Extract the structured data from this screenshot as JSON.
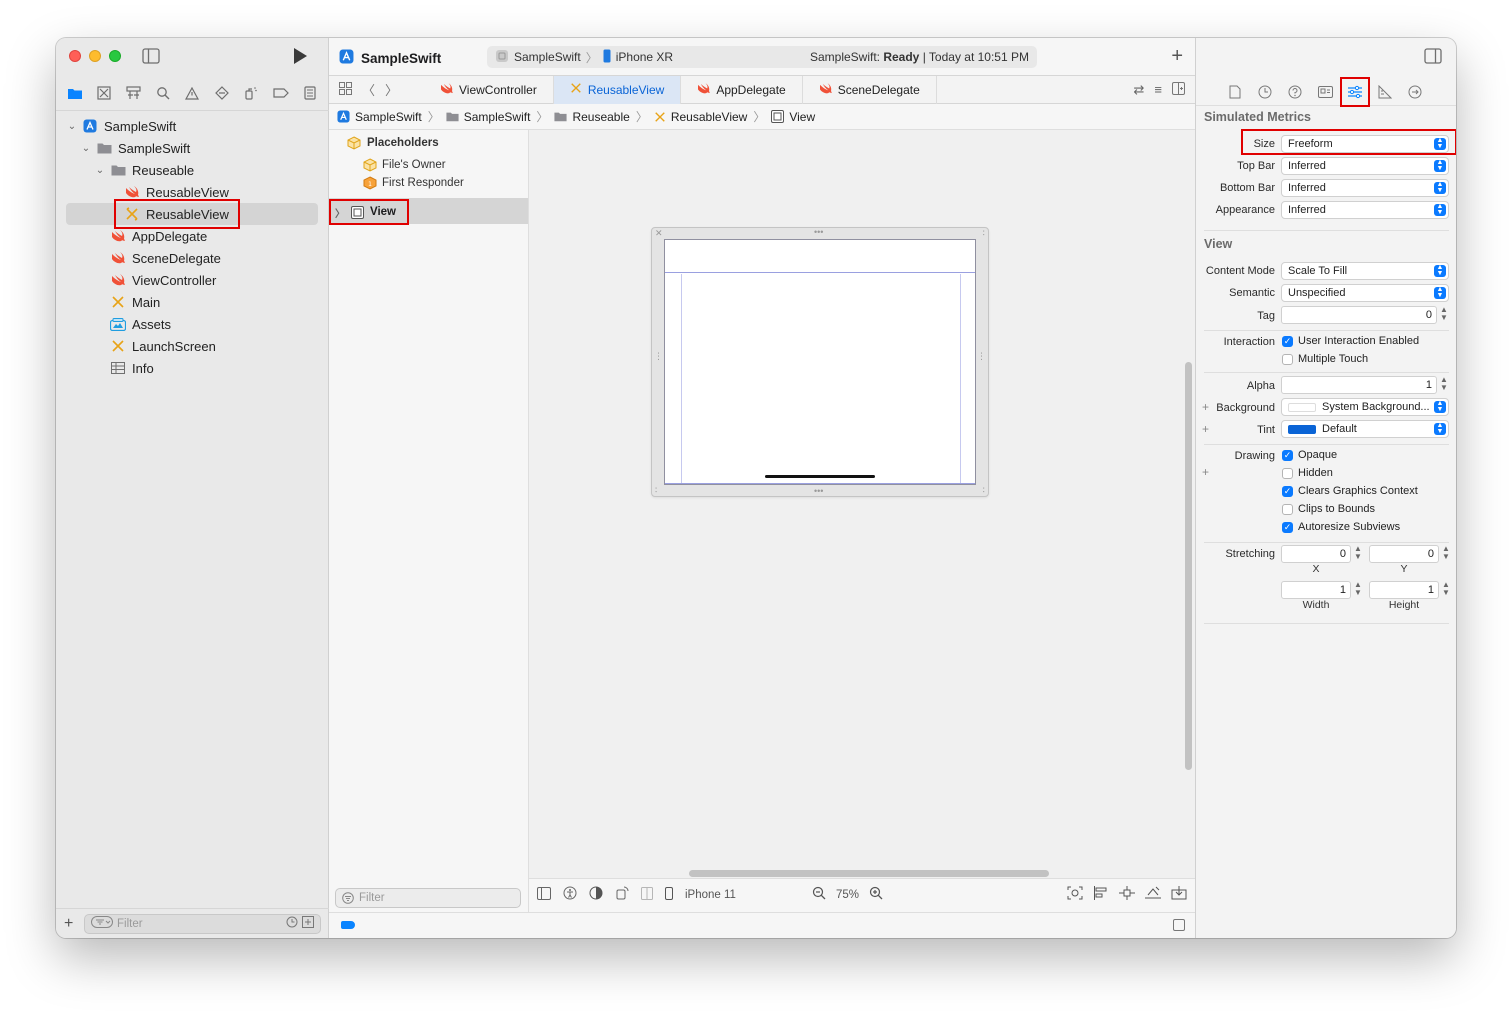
{
  "app": {
    "title": "SampleSwift"
  },
  "scheme": {
    "project": "SampleSwift",
    "device": "iPhone XR",
    "status_prefix": "SampleSwift: ",
    "status_state": "Ready",
    "status_time": " | Today at 10:51 PM"
  },
  "navigator": {
    "tree": [
      {
        "label": "SampleSwift",
        "icon": "app-project-icon",
        "depth": 0,
        "chevron": "open"
      },
      {
        "label": "SampleSwift",
        "icon": "folder-icon",
        "depth": 1,
        "chevron": "open"
      },
      {
        "label": "Reuseable",
        "icon": "folder-icon",
        "depth": 2,
        "chevron": "open"
      },
      {
        "label": "ReusableView",
        "icon": "swift-file-icon",
        "depth": 3
      },
      {
        "label": "ReusableView",
        "icon": "xib-file-icon",
        "depth": 3,
        "selected": true
      },
      {
        "label": "AppDelegate",
        "icon": "swift-file-icon",
        "depth": 2
      },
      {
        "label": "SceneDelegate",
        "icon": "swift-file-icon",
        "depth": 2
      },
      {
        "label": "ViewController",
        "icon": "swift-file-icon",
        "depth": 2
      },
      {
        "label": "Main",
        "icon": "storyboard-file-icon",
        "depth": 2
      },
      {
        "label": "Assets",
        "icon": "asset-catalog-icon",
        "depth": 2
      },
      {
        "label": "LaunchScreen",
        "icon": "storyboard-file-icon",
        "depth": 2
      },
      {
        "label": "Info",
        "icon": "plist-table-icon",
        "depth": 2
      }
    ],
    "filter_placeholder": "Filter"
  },
  "tabs": [
    {
      "label": "ViewController",
      "icon": "swift-file-icon"
    },
    {
      "label": "ReusableView",
      "icon": "xib-file-icon",
      "active": true
    },
    {
      "label": "AppDelegate",
      "icon": "swift-file-icon"
    },
    {
      "label": "SceneDelegate",
      "icon": "swift-file-icon"
    }
  ],
  "jumpbar": [
    {
      "label": "SampleSwift",
      "icon": "app-project-icon"
    },
    {
      "label": "SampleSwift",
      "icon": "folder-icon"
    },
    {
      "label": "Reuseable",
      "icon": "folder-icon"
    },
    {
      "label": "ReusableView",
      "icon": "xib-file-icon"
    },
    {
      "label": "View",
      "icon": "view-icon"
    }
  ],
  "outline": {
    "placeholders": "Placeholders",
    "files_owner": "File's Owner",
    "first_responder": "First Responder",
    "view": "View",
    "filter_placeholder": "Filter"
  },
  "canvas_bar": {
    "device": "iPhone 11",
    "zoom": "75%"
  },
  "inspector": {
    "simulated_metrics": {
      "title": "Simulated Metrics",
      "size_label": "Size",
      "size_value": "Freeform",
      "top_bar_label": "Top Bar",
      "top_bar_value": "Inferred",
      "bottom_bar_label": "Bottom Bar",
      "bottom_bar_value": "Inferred",
      "appearance_label": "Appearance",
      "appearance_value": "Inferred"
    },
    "view": {
      "title": "View",
      "content_mode_label": "Content Mode",
      "content_mode_value": "Scale To Fill",
      "semantic_label": "Semantic",
      "semantic_value": "Unspecified",
      "tag_label": "Tag",
      "tag_value": "0",
      "interaction_label": "Interaction",
      "user_interaction": "User Interaction Enabled",
      "user_interaction_checked": true,
      "multiple_touch": "Multiple Touch",
      "multiple_touch_checked": false,
      "alpha_label": "Alpha",
      "alpha_value": "1",
      "background_label": "Background",
      "background_value": "System Background...",
      "tint_label": "Tint",
      "tint_value": "Default",
      "tint_color": "#0a64d6",
      "drawing_label": "Drawing",
      "opaque": "Opaque",
      "opaque_checked": true,
      "hidden": "Hidden",
      "hidden_checked": false,
      "clears_graphics": "Clears Graphics Context",
      "clears_graphics_checked": true,
      "clips_bounds": "Clips to Bounds",
      "clips_bounds_checked": false,
      "autoresize": "Autoresize Subviews",
      "autoresize_checked": true,
      "stretching_label": "Stretching",
      "stretch_x": "0",
      "stretch_y": "0",
      "stretch_w": "1",
      "stretch_h": "1",
      "x_label": "X",
      "y_label": "Y",
      "width_label": "Width",
      "height_label": "Height"
    }
  },
  "colors": {
    "accent": "#0a84ff",
    "highlight": "#e00000",
    "selected_tab_bg": "#dbe6f5"
  }
}
